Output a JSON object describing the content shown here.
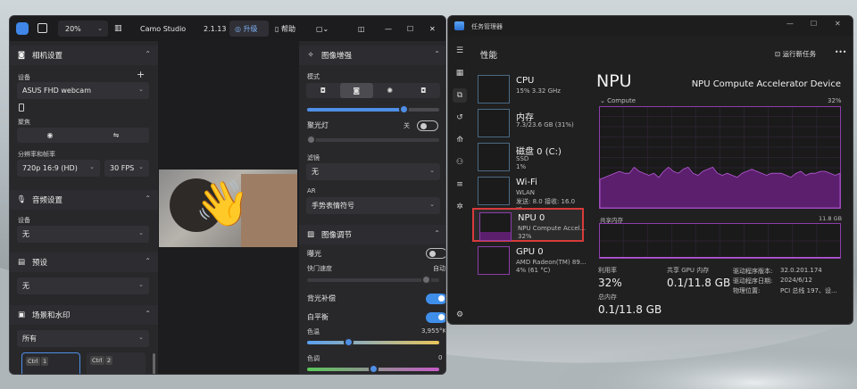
{
  "camo": {
    "zoom": "20%",
    "app_name": "Camo Studio",
    "version": "2.1.13",
    "upgrade_label": "升级",
    "help_label": "帮助",
    "camera": {
      "title": "相机设置",
      "device_label": "设备",
      "device_value": "ASUS FHD webcam",
      "focus_label": "聚焦",
      "resolution_label": "分辨率和帧率",
      "resolution_value": "720p 16:9 (HD)",
      "fps_value": "30 FPS"
    },
    "audio": {
      "title": "音频设置",
      "device_label": "设备",
      "device_value": "无"
    },
    "preset": {
      "title": "预设",
      "value": "无"
    },
    "scenes": {
      "title": "场景和水印",
      "filter_value": "所有",
      "scene1_key": "Ctrl",
      "scene1_num": "1",
      "scene2_key": "Ctrl",
      "scene2_num": "2"
    },
    "enhance": {
      "title": "图像增强",
      "mode_label": "模式",
      "spotlight_label": "聚光灯",
      "spotlight_state": "关",
      "filter_label": "滤镜",
      "filter_value": "无",
      "ar_label": "AR",
      "ar_value": "手势表情符号",
      "mode_slider_value": 0.73
    },
    "adjust": {
      "title": "图像调节",
      "exposure_label": "曝光",
      "shutter_label": "快门速度",
      "shutter_value": "自动",
      "backlight_label": "背光补偿",
      "wb_label": "白平衡",
      "temp_label": "色温",
      "temp_value": "3,955°K",
      "tint_label": "色调",
      "tint_value": "0",
      "temp_slider": 0.31,
      "tint_slider": 0.5
    },
    "video_emoji": "👋"
  },
  "tm": {
    "title": "任务管理器",
    "page_title": "性能",
    "run_task_label": "运行新任务",
    "more_label": "•••",
    "tiles": [
      {
        "name": "CPU",
        "line2": "15% 3.32 GHz",
        "line3": ""
      },
      {
        "name": "内存",
        "line2": "7.3/23.6 GB (31%)",
        "line3": ""
      },
      {
        "name": "磁盘 0 (C:)",
        "line2": "SSD",
        "line3": "1%"
      },
      {
        "name": "Wi-Fi",
        "line2": "WLAN",
        "line3": "发送: 8.0 接收: 16.0 Kb"
      },
      {
        "name": "NPU 0",
        "line2": "NPU Compute Accel...",
        "line3": "32%"
      },
      {
        "name": "GPU 0",
        "line2": "AMD Radeon(TM) 89...",
        "line3": "4% (61 °C)"
      }
    ],
    "detail": {
      "heading": "NPU",
      "device_name": "NPU Compute Accelerator Device",
      "graph_label": "Compute",
      "graph_max": "32%",
      "mem_label": "共享内存",
      "mem_max": "11.8 GB",
      "util_label": "利用率",
      "util_value": "32%",
      "shared_label": "共享 GPU 内存",
      "shared_value": "0.1/11.8 GB",
      "total_label": "总内存",
      "total_value": "0.1/11.8 GB",
      "info": [
        {
          "k": "驱动程序版本:",
          "v": "32.0.201.174"
        },
        {
          "k": "驱动程序日期:",
          "v": "2024/6/12"
        },
        {
          "k": "物理位置:",
          "v": "PCI 总线 197、设..."
        }
      ]
    },
    "compute_series": [
      0.14,
      0.15,
      0.16,
      0.17,
      0.18,
      0.17,
      0.17,
      0.2,
      0.18,
      0.17,
      0.16,
      0.17,
      0.15,
      0.18,
      0.2,
      0.18,
      0.17,
      0.19,
      0.2,
      0.17,
      0.16,
      0.18,
      0.19,
      0.2,
      0.17,
      0.16,
      0.17,
      0.16,
      0.15,
      0.17,
      0.18,
      0.19,
      0.18,
      0.17,
      0.16,
      0.17,
      0.17,
      0.17,
      0.16,
      0.15,
      0.17,
      0.18,
      0.16,
      0.17,
      0.17,
      0.18,
      0.18,
      0.17,
      0.16,
      0.17
    ],
    "colors": {
      "npu": "#8e3cab",
      "highlight": "#d83b3b",
      "accent": "#4f8fe6"
    }
  }
}
